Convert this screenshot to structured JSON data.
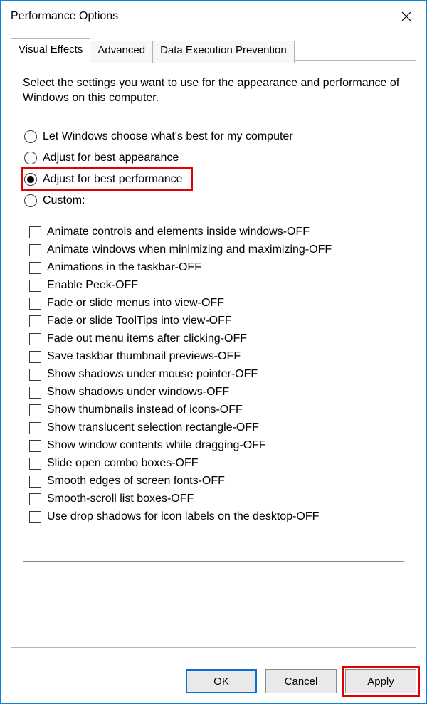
{
  "window": {
    "title": "Performance Options"
  },
  "tabs": [
    {
      "label": "Visual Effects",
      "active": true
    },
    {
      "label": "Advanced",
      "active": false
    },
    {
      "label": "Data Execution Prevention",
      "active": false
    }
  ],
  "intro": "Select the settings you want to use for the appearance and performance of Windows on this computer.",
  "radios": [
    {
      "label": "Let Windows choose what's best for my computer",
      "checked": false,
      "highlight": false
    },
    {
      "label": "Adjust for best appearance",
      "checked": false,
      "highlight": false
    },
    {
      "label": "Adjust for best performance",
      "checked": true,
      "highlight": true
    },
    {
      "label": "Custom:",
      "checked": false,
      "highlight": false
    }
  ],
  "checks": [
    {
      "label": "Animate controls and elements inside windows-OFF",
      "checked": false
    },
    {
      "label": "Animate windows when minimizing and maximizing-OFF",
      "checked": false
    },
    {
      "label": "Animations in the taskbar-OFF",
      "checked": false
    },
    {
      "label": "Enable Peek-OFF",
      "checked": false
    },
    {
      "label": "Fade or slide menus into view-OFF",
      "checked": false
    },
    {
      "label": "Fade or slide ToolTips into view-OFF",
      "checked": false
    },
    {
      "label": "Fade out menu items after clicking-OFF",
      "checked": false
    },
    {
      "label": "Save taskbar thumbnail previews-OFF",
      "checked": false
    },
    {
      "label": "Show shadows under mouse pointer-OFF",
      "checked": false
    },
    {
      "label": "Show shadows under windows-OFF",
      "checked": false
    },
    {
      "label": "Show thumbnails instead of icons-OFF",
      "checked": false
    },
    {
      "label": "Show translucent selection rectangle-OFF",
      "checked": false
    },
    {
      "label": "Show window contents while dragging-OFF",
      "checked": false
    },
    {
      "label": "Slide open combo boxes-OFF",
      "checked": false
    },
    {
      "label": "Smooth edges of screen fonts-OFF",
      "checked": false
    },
    {
      "label": "Smooth-scroll list boxes-OFF",
      "checked": false
    },
    {
      "label": "Use drop shadows for icon labels on the desktop-OFF",
      "checked": false
    }
  ],
  "buttons": {
    "ok": "OK",
    "cancel": "Cancel",
    "apply": "Apply"
  }
}
